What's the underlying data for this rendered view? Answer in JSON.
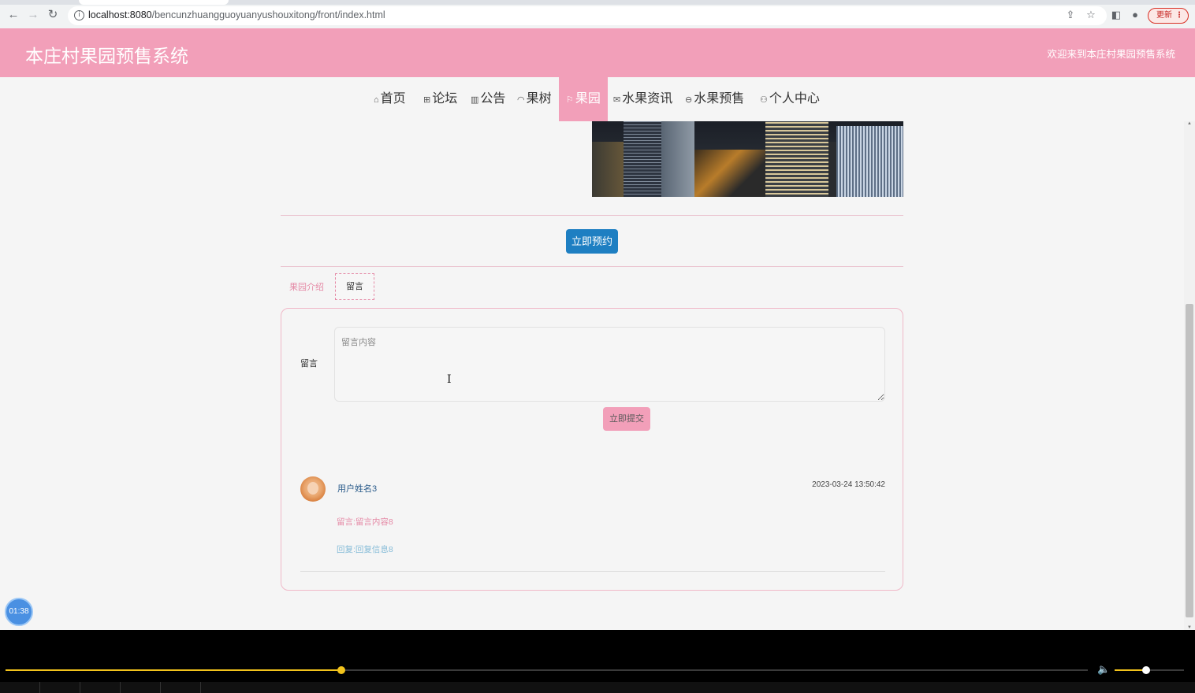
{
  "browser": {
    "url_host": "localhost:8080",
    "url_path": "/bencunzhuangguoyuanyushouxitong/front/index.html",
    "update_label": "更新"
  },
  "header": {
    "site_title": "本庄村果园预售系统",
    "welcome": "欢迎来到本庄村果园预售系统"
  },
  "nav": {
    "items": [
      {
        "label": "首页",
        "icon": "home-icon",
        "glyph": "⌂"
      },
      {
        "label": "论坛",
        "icon": "forum-icon",
        "glyph": "⊞"
      },
      {
        "label": "公告",
        "icon": "notice-icon",
        "glyph": "▥"
      },
      {
        "label": "果树",
        "icon": "tree-icon",
        "glyph": "◠"
      },
      {
        "label": "果园",
        "icon": "flag-icon",
        "glyph": "⚐"
      },
      {
        "label": "水果资讯",
        "icon": "mail-icon",
        "glyph": "✉"
      },
      {
        "label": "水果预售",
        "icon": "sale-icon",
        "glyph": "⊖"
      },
      {
        "label": "个人中心",
        "icon": "user-icon",
        "glyph": "⚇"
      }
    ],
    "active": "果园"
  },
  "detail": {
    "reserve_label": "立即预约"
  },
  "tabs": {
    "intro_label": "果园介绍",
    "message_label": "留言"
  },
  "message_form": {
    "label": "留言",
    "placeholder": "留言内容",
    "submit_label": "立即提交"
  },
  "messages": [
    {
      "user": "用户姓名3",
      "time": "2023-03-24 13:50:42",
      "content": "留言:留言内容8",
      "reply": "回复:回复信息8"
    }
  ],
  "timer": "01:38",
  "player": {
    "progress": 0.31,
    "volume": 0.45
  },
  "colors": {
    "primary_pink": "#f29fb9",
    "button_blue": "#1e7fc2",
    "progress_yellow": "#f2c31c"
  }
}
